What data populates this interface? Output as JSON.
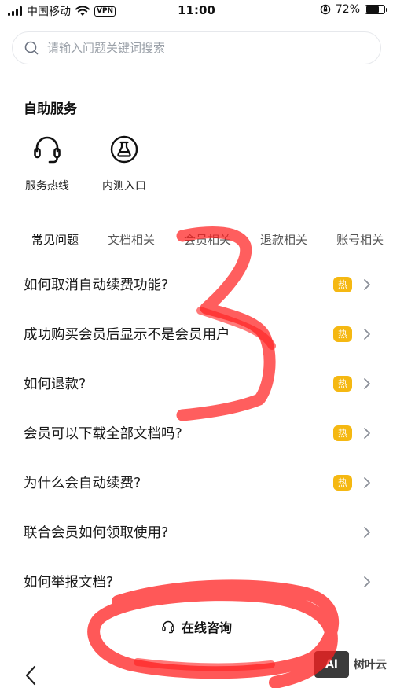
{
  "status_bar": {
    "carrier": "中国移动",
    "vpn": "VPN",
    "time": "11:00",
    "battery": "72%",
    "battery_level": 0.72
  },
  "search": {
    "placeholder": "请输入问题关键词搜索"
  },
  "self_service": {
    "title": "自助服务",
    "items": [
      {
        "label": "服务热线",
        "icon": "headset-icon"
      },
      {
        "label": "内测入口",
        "icon": "flask-icon"
      }
    ]
  },
  "tabs": [
    {
      "label": "常见问题",
      "active": true
    },
    {
      "label": "文档相关",
      "active": false
    },
    {
      "label": "会员相关",
      "active": false
    },
    {
      "label": "退款相关",
      "active": false
    },
    {
      "label": "账号相关",
      "active": false
    }
  ],
  "faq": [
    {
      "question": "如何取消自动续费功能?",
      "hot": true
    },
    {
      "question": "成功购买会员后显示不是会员用户",
      "hot": true
    },
    {
      "question": "如何退款?",
      "hot": true
    },
    {
      "question": "会员可以下载全部文档吗?",
      "hot": true
    },
    {
      "question": "为什么会自动续费?",
      "hot": true
    },
    {
      "question": "联合会员如何领取使用?",
      "hot": false
    },
    {
      "question": "如何举报文档?",
      "hot": false
    }
  ],
  "hot_badge": "热",
  "consult": {
    "label": "在线咨询"
  },
  "watermark": {
    "logo": "AI",
    "text": "树叶云"
  },
  "colors": {
    "accent": "#2a6bf2",
    "hot": "#f5b812",
    "marker": "#ff2020"
  }
}
